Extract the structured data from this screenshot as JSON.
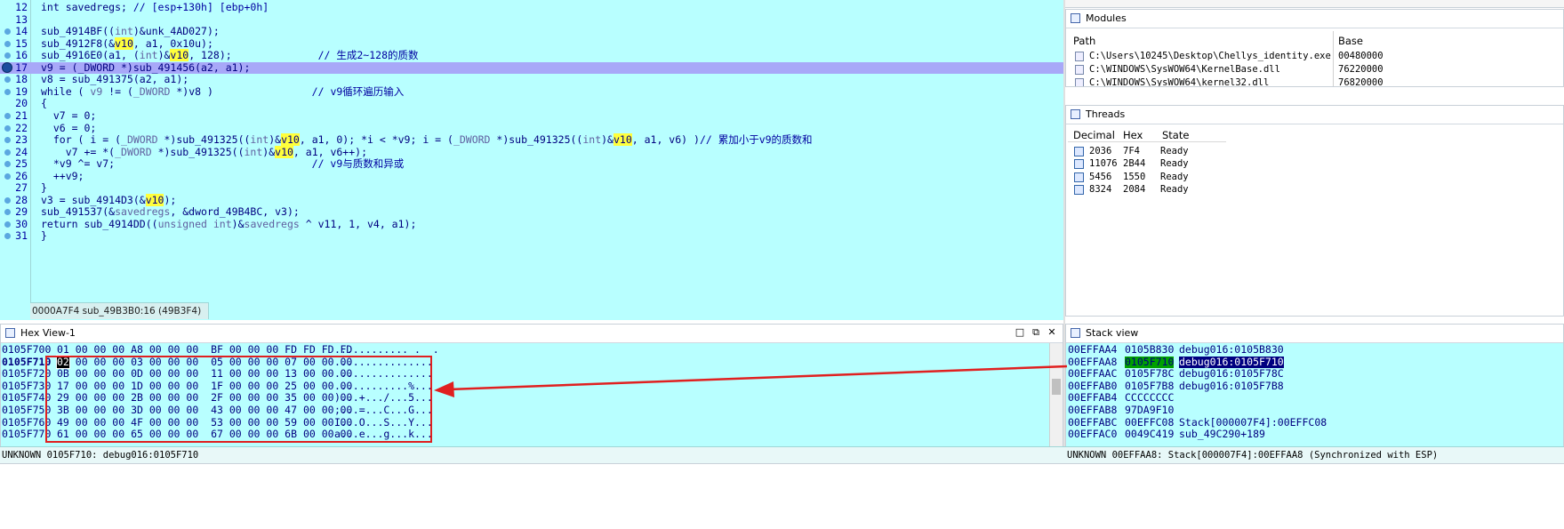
{
  "pseudocode": {
    "status": "0000A7F4 sub_49B3B0:16 (49B3F4)",
    "lines": [
      {
        "n": "12",
        "dot": false,
        "hl": false,
        "parts": [
          [
            "t",
            "int savedregs; "
          ],
          [
            "c",
            "// [esp+130h] [ebp+0h]"
          ]
        ]
      },
      {
        "n": "13",
        "dot": false,
        "hl": false,
        "parts": []
      },
      {
        "n": "14",
        "dot": true,
        "hl": false,
        "parts": [
          [
            "t",
            "sub_4914BF(("
          ],
          [
            "g",
            "int"
          ],
          [
            "t",
            ")&unk_4AD027);"
          ]
        ]
      },
      {
        "n": "15",
        "dot": true,
        "hl": false,
        "parts": [
          [
            "t",
            "sub_4912F8(&"
          ],
          [
            "v",
            "v10"
          ],
          [
            "t",
            ", a1, 0x10u);"
          ]
        ]
      },
      {
        "n": "16",
        "dot": true,
        "hl": false,
        "parts": [
          [
            "t",
            "sub_4916E0(a1, ("
          ],
          [
            "g",
            "int"
          ],
          [
            "t",
            ")&"
          ],
          [
            "v",
            "v10"
          ],
          [
            "t",
            ", 128);              "
          ],
          [
            "c",
            "// 生成2~128的质数"
          ]
        ]
      },
      {
        "n": "17",
        "dot": "big",
        "hl": true,
        "parts": [
          [
            "t",
            "v9 = (_DWORD *)sub_491456(a2, a1);"
          ]
        ]
      },
      {
        "n": "18",
        "dot": true,
        "hl": false,
        "parts": [
          [
            "t",
            "v8 = sub_491375(a2, a1);"
          ]
        ]
      },
      {
        "n": "19",
        "dot": true,
        "hl": false,
        "parts": [
          [
            "t",
            "while ( "
          ],
          [
            "g",
            "v9"
          ],
          [
            "t",
            " != ("
          ],
          [
            "g",
            "_DWORD"
          ],
          [
            "t",
            " *)v8 )                "
          ],
          [
            "c",
            "// v9循环遍历输入"
          ]
        ]
      },
      {
        "n": "20",
        "dot": false,
        "hl": false,
        "parts": [
          [
            "t",
            "{"
          ]
        ]
      },
      {
        "n": "21",
        "dot": true,
        "hl": false,
        "parts": [
          [
            "t",
            "  v7 = 0;"
          ]
        ]
      },
      {
        "n": "22",
        "dot": true,
        "hl": false,
        "parts": [
          [
            "t",
            "  v6 = 0;"
          ]
        ]
      },
      {
        "n": "23",
        "dot": true,
        "hl": false,
        "parts": [
          [
            "t",
            "  for ( i = ("
          ],
          [
            "g",
            "_DWORD"
          ],
          [
            "t",
            " *)sub_491325(("
          ],
          [
            "g",
            "int"
          ],
          [
            "t",
            ")&"
          ],
          [
            "v",
            "v10"
          ],
          [
            "t",
            ", a1, 0); *i < *v9; i = ("
          ],
          [
            "g",
            "_DWORD"
          ],
          [
            "t",
            " *)sub_491325(("
          ],
          [
            "g",
            "int"
          ],
          [
            "t",
            ")&"
          ],
          [
            "v",
            "v10"
          ],
          [
            "t",
            ", a1, v6) )"
          ],
          [
            "c",
            "// 累加小于v9的质数和"
          ]
        ]
      },
      {
        "n": "24",
        "dot": true,
        "hl": false,
        "parts": [
          [
            "t",
            "    v7 += *("
          ],
          [
            "g",
            "_DWORD"
          ],
          [
            "t",
            " *)sub_491325(("
          ],
          [
            "g",
            "int"
          ],
          [
            "t",
            ")&"
          ],
          [
            "v",
            "v10"
          ],
          [
            "t",
            ", a1, v6++);"
          ]
        ]
      },
      {
        "n": "25",
        "dot": true,
        "hl": false,
        "parts": [
          [
            "t",
            "  *v9 ^= v7;                                "
          ],
          [
            "c",
            "// v9与质数和异或"
          ]
        ]
      },
      {
        "n": "26",
        "dot": true,
        "hl": false,
        "parts": [
          [
            "t",
            "  ++v9;"
          ]
        ]
      },
      {
        "n": "27",
        "dot": false,
        "hl": false,
        "parts": [
          [
            "t",
            "}"
          ]
        ]
      },
      {
        "n": "28",
        "dot": true,
        "hl": false,
        "parts": [
          [
            "t",
            "v3 = sub_4914D3(&"
          ],
          [
            "v",
            "v10"
          ],
          [
            "t",
            ");"
          ]
        ]
      },
      {
        "n": "29",
        "dot": true,
        "hl": false,
        "parts": [
          [
            "t",
            "sub_491537(&"
          ],
          [
            "g",
            "savedregs"
          ],
          [
            "t",
            ", &dword_49B4BC, v3);"
          ]
        ]
      },
      {
        "n": "30",
        "dot": true,
        "hl": false,
        "parts": [
          [
            "t",
            "return sub_4914DD(("
          ],
          [
            "g",
            "unsigned int"
          ],
          [
            "t",
            ")&"
          ],
          [
            "g",
            "savedregs"
          ],
          [
            "t",
            " ^ v11, 1, v4, a1);"
          ]
        ]
      },
      {
        "n": "31",
        "dot": true,
        "hl": false,
        "parts": [
          [
            "t",
            "}"
          ]
        ]
      }
    ]
  },
  "modules": {
    "title": "Modules",
    "col_path": "Path",
    "col_base": "Base",
    "rows": [
      {
        "path": "C:\\Users\\10245\\Desktop\\Chellys_identity.exe",
        "base": "00480000"
      },
      {
        "path": "C:\\WINDOWS\\SysWOW64\\KernelBase.dll",
        "base": "76220000"
      },
      {
        "path": "C:\\WINDOWS\\SysWOW64\\kernel32.dll",
        "base": "76820000"
      }
    ]
  },
  "threads": {
    "title": "Threads",
    "cols": [
      "Decimal",
      "Hex",
      "State"
    ],
    "rows": [
      [
        "2036",
        "7F4",
        "Ready"
      ],
      [
        "11076",
        "2B44",
        "Ready"
      ],
      [
        "5456",
        "1550",
        "Ready"
      ],
      [
        "8324",
        "2084",
        "Ready"
      ]
    ]
  },
  "hex": {
    "title": "Hex View-1",
    "status": "UNKNOWN 0105F710: debug016:0105F710",
    "rows": [
      {
        "addr": "0105F700",
        "bytes": "01 00 00 00 A8 00 00 00  BF 00 00 00 FD FD FD FD",
        "ascii": "............ .  .",
        "sel": false
      },
      {
        "addr": "0105F710",
        "first": "02",
        "bytes": " 00 00 00 03 00 00 00  05 00 00 00 07 00 00 00",
        "ascii": "................",
        "sel": true
      },
      {
        "addr": "0105F720",
        "bytes": "0B 00 00 00 0D 00 00 00  11 00 00 00 13 00 00 00",
        "ascii": "................",
        "sel": false
      },
      {
        "addr": "0105F730",
        "bytes": "17 00 00 00 1D 00 00 00  1F 00 00 00 25 00 00 00",
        "ascii": "............%...",
        "sel": false
      },
      {
        "addr": "0105F740",
        "bytes": "29 00 00 00 2B 00 00 00  2F 00 00 00 35 00 00 00",
        "ascii": ")...+.../...5...",
        "sel": false
      },
      {
        "addr": "0105F750",
        "bytes": "3B 00 00 00 3D 00 00 00  43 00 00 00 47 00 00 00",
        "ascii": ";...=...C...G...",
        "sel": false
      },
      {
        "addr": "0105F760",
        "bytes": "49 00 00 00 4F 00 00 00  53 00 00 00 59 00 00 00",
        "ascii": "I...O...S...Y...",
        "sel": false
      },
      {
        "addr": "0105F770",
        "bytes": "61 00 00 00 65 00 00 00  67 00 00 00 6B 00 00 00",
        "ascii": "a...e...g...k...",
        "sel": false
      }
    ]
  },
  "stack": {
    "title": "Stack view",
    "status": "UNKNOWN 00EFFAA8: Stack[000007F4]:00EFFAA8 (Synchronized with ESP)",
    "rows": [
      {
        "a": "00EFFAA4",
        "v": "0105B830",
        "c": "debug016:0105B830",
        "sel": false
      },
      {
        "a": "00EFFAA8",
        "v": "0105F710",
        "c": "debug016:0105F710",
        "sel": true
      },
      {
        "a": "00EFFAAC",
        "v": "0105F78C",
        "c": "debug016:0105F78C",
        "sel": false
      },
      {
        "a": "00EFFAB0",
        "v": "0105F7B8",
        "c": "debug016:0105F7B8",
        "sel": false
      },
      {
        "a": "00EFFAB4",
        "v": "CCCCCCCC",
        "c": "",
        "sel": false
      },
      {
        "a": "00EFFAB8",
        "v": "97DA9F10",
        "c": "",
        "sel": false
      },
      {
        "a": "00EFFABC",
        "v": "00EFFC08",
        "c": "Stack[000007F4]:00EFFC08",
        "sel": false
      },
      {
        "a": "00EFFAC0",
        "v": "0049C419",
        "c": "sub_49C290+189",
        "sel": false
      }
    ]
  },
  "colors": {
    "bg_cyan": "#b8ffff",
    "highlight_line": "#a8a8f8",
    "var_highlight": "#ffff3c",
    "annotation_red": "#e02020"
  }
}
